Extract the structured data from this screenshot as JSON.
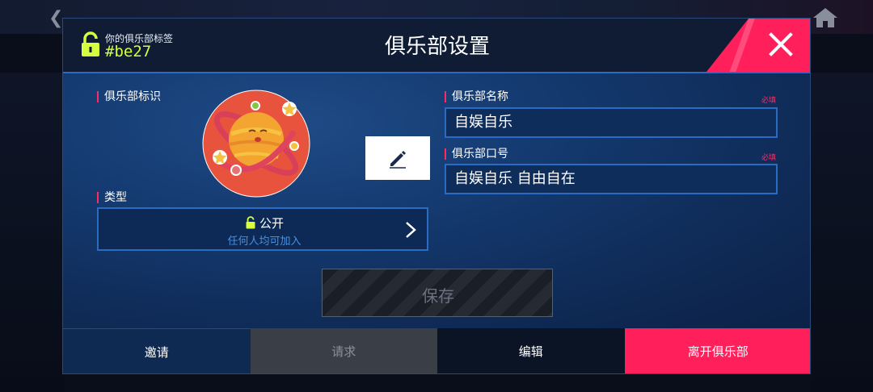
{
  "club_tag": {
    "label": "你的俱乐部标签",
    "value": "#be27"
  },
  "title": "俱乐部设置",
  "sections": {
    "emblem_label": "俱乐部标识",
    "type_label": "类型",
    "name_label": "俱乐部名称",
    "motto_label": "俱乐部口号",
    "required_text": "必填"
  },
  "type_select": {
    "value": "公开",
    "description": "任何人均可加入"
  },
  "fields": {
    "club_name": "自娱自乐",
    "club_motto": "自娱自乐 自由自在"
  },
  "save_label": "保存",
  "tabs": [
    {
      "label": "邀请"
    },
    {
      "label": "请求"
    },
    {
      "label": "编辑"
    },
    {
      "label": "离开俱乐部"
    }
  ],
  "colors": {
    "accent_pink": "#ff1f5a",
    "tag_green": "#d6ff3d",
    "border_blue": "#2a6cc4"
  },
  "icons": [
    "lock-icon",
    "close-icon",
    "pencil-icon",
    "chevron-right-icon",
    "planet-emblem-icon",
    "home-icon"
  ]
}
